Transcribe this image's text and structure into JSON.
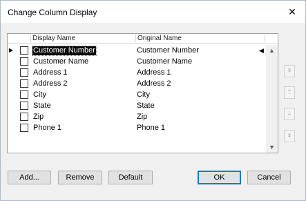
{
  "window": {
    "title": "Change Column Display",
    "close_glyph": "✕"
  },
  "grid": {
    "headers": {
      "display_name": "Display Name",
      "original_name": "Original Name"
    },
    "rows": [
      {
        "display": "Customer Number",
        "original": "Customer Number",
        "selected": true,
        "current": true
      },
      {
        "display": "Customer Name",
        "original": "Customer Name"
      },
      {
        "display": "Address 1",
        "original": "Address 1"
      },
      {
        "display": "Address 2",
        "original": "Address 2"
      },
      {
        "display": "City",
        "original": "City"
      },
      {
        "display": "State",
        "original": "State"
      },
      {
        "display": "Zip",
        "original": "Zip"
      },
      {
        "display": "Phone 1",
        "original": "Phone 1"
      }
    ],
    "row_pointer_glyph": "▶",
    "row_marker_glyph": "◀",
    "scroll_up_glyph": "▲",
    "scroll_down_glyph": "▼"
  },
  "side_buttons": [
    {
      "name": "move-top-button",
      "glyph": "⇞"
    },
    {
      "name": "move-up-button",
      "glyph": "⇡"
    },
    {
      "name": "move-down-button",
      "glyph": "⇣"
    },
    {
      "name": "move-bottom-button",
      "glyph": "⇟"
    }
  ],
  "buttons": {
    "add": "Add...",
    "remove": "Remove",
    "default": "Default",
    "ok": "OK",
    "cancel": "Cancel"
  }
}
